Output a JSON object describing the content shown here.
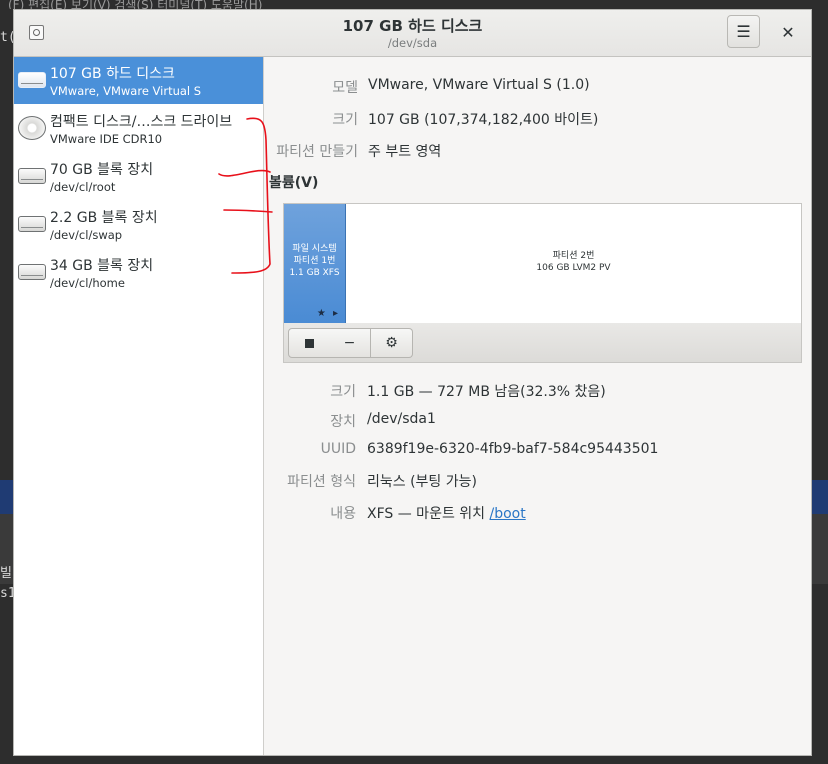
{
  "background": {
    "menu_fragment": "(F)  편집(E)  보기(V)  검색(S)  터미널(T)  도움말(H)",
    "terminal_fragment_1": "t(",
    "terminal_fragment_2": "빌(",
    "terminal_fragment_3": "s1"
  },
  "titlebar": {
    "title": "107 GB 하드 디스크",
    "subtitle": "/dev/sda",
    "menu_glyph": "☰",
    "close_glyph": "✕"
  },
  "sidebar": {
    "items": [
      {
        "title": "107 GB 하드 디스크",
        "subtitle": "VMware, VMware Virtual S",
        "icon": "hard-disk-icon",
        "selected": true
      },
      {
        "title": "컴팩트 디스크/…스크 드라이브",
        "subtitle": "VMware IDE CDR10",
        "icon": "optical-drive-icon",
        "selected": false
      },
      {
        "title": "70 GB 블록 장치",
        "subtitle": "/dev/cl/root",
        "icon": "block-device-icon",
        "selected": false
      },
      {
        "title": "2.2 GB 블록 장치",
        "subtitle": "/dev/cl/swap",
        "icon": "block-device-icon",
        "selected": false
      },
      {
        "title": "34 GB 블록 장치",
        "subtitle": "/dev/cl/home",
        "icon": "block-device-icon",
        "selected": false
      }
    ]
  },
  "drive": {
    "model_label": "모델",
    "model_value": "VMware, VMware Virtual S (1.0)",
    "size_label": "크기",
    "size_value": "107 GB (107,374,182,400 바이트)",
    "partitioning_label": "파티션 만들기",
    "partitioning_value": "주 부트 영역"
  },
  "volumes": {
    "heading": "볼륨(V)",
    "segments": [
      {
        "line1": "파일 시스템",
        "line2": "파티션 1번",
        "line3": "1.1 GB XFS",
        "glyphs": "★ ▸"
      },
      {
        "line1": "파티션 2번",
        "line2": "106 GB LVM2 PV"
      }
    ],
    "toolbar": {
      "minus_glyph": "−",
      "gear_glyph": "⚙"
    }
  },
  "partition": {
    "size_label": "크기",
    "size_value": "1.1 GB — 727 MB 남음(32.3% 찼음)",
    "device_label": "장치",
    "device_value": "/dev/sda1",
    "uuid_label": "UUID",
    "uuid_value": "6389f19e-6320-4fb9-baf7-584c95443501",
    "type_label": "파티션 형식",
    "type_value": "리눅스 (부팅 가능)",
    "contents_label": "내용",
    "contents_prefix": "XFS — 마운트 위치 ",
    "contents_link": "/boot"
  },
  "colors": {
    "selection": "#4a90d9",
    "annotation": "#e8101a",
    "link": "#2a76c6"
  }
}
